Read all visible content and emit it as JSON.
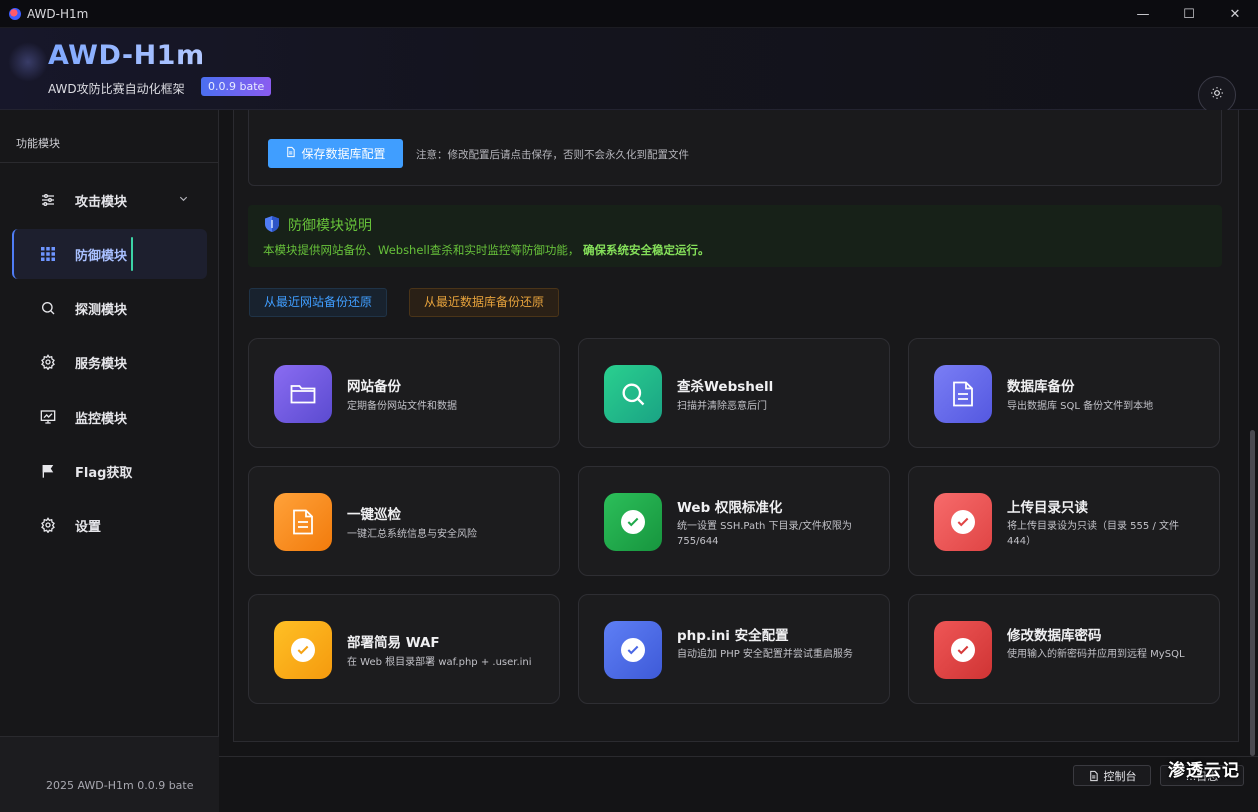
{
  "window": {
    "title": "AWD-H1m",
    "controls": {
      "minimize": "—",
      "maximize": "☐",
      "close": "✕"
    }
  },
  "header": {
    "brand": "AWD-H1m",
    "subtitle": "AWD攻防比赛自动化框架",
    "version": "0.0.9 bate",
    "theme_icon": "sun-icon"
  },
  "sidebar": {
    "section_title": "功能模块",
    "items": [
      {
        "label": "攻击模块",
        "icon": "sliders-icon",
        "has_submenu": true
      },
      {
        "label": "防御模块",
        "icon": "grid-icon",
        "active": true
      },
      {
        "label": "探测模块",
        "icon": "search-icon"
      },
      {
        "label": "服务模块",
        "icon": "gear-icon"
      },
      {
        "label": "监控模块",
        "icon": "monitor-chart-icon"
      },
      {
        "label": "Flag获取",
        "icon": "flag-icon"
      },
      {
        "label": "设置",
        "icon": "gear-icon"
      }
    ],
    "footer": "2025 AWD-H1m 0.0.9 bate"
  },
  "main": {
    "db_config": {
      "save_label": "保存数据库配置",
      "note": "注意：修改配置后请点击保存，否则不会永久化到配置文件"
    },
    "info": {
      "title": "防御模块说明",
      "text": "本模块提供网站备份、Webshell查杀和实时监控等防御功能，",
      "text_bold": "确保系统安全稳定运行。"
    },
    "restore": {
      "web_label": "从最近网站备份还原",
      "db_label": "从最近数据库备份还原"
    },
    "tools": [
      {
        "name": "网站备份",
        "desc": "定期备份网站文件和数据",
        "icon": "folder-icon",
        "color": "#7c5ce0"
      },
      {
        "name": "查杀Webshell",
        "desc": "扫描并清除恶意后门",
        "icon": "search-icon",
        "color": "#22c08a"
      },
      {
        "name": "数据库备份",
        "desc": "导出数据库 SQL 备份文件到本地",
        "icon": "document-icon",
        "color": "#6a6ef0"
      },
      {
        "name": "一键巡检",
        "desc": "一键汇总系统信息与安全风险",
        "icon": "document-icon",
        "color": "#f5901e"
      },
      {
        "name": "Web 权限标准化",
        "desc": "统一设置 SSH.Path 下目录/文件权限为 755/644",
        "icon": "check-circle-icon",
        "color": "#22a84a"
      },
      {
        "name": "上传目录只读",
        "desc": "将上传目录设为只读（目录 555 / 文件 444）",
        "icon": "check-circle-icon",
        "color": "#f05a5a"
      },
      {
        "name": "部署简易 WAF",
        "desc": "在 Web 根目录部署 waf.php + .user.ini",
        "icon": "check-circle-icon",
        "color": "#f7a91a"
      },
      {
        "name": "php.ini 安全配置",
        "desc": "自动追加 PHP 安全配置并尝试重启服务",
        "icon": "check-circle-icon",
        "color": "#4f6ef0"
      },
      {
        "name": "修改数据库密码",
        "desc": "使用输入的新密码并应用到远程 MySQL",
        "icon": "check-circle-icon",
        "color": "#e64a4a"
      }
    ]
  },
  "bottombar": {
    "console_label": "控制台",
    "second_label": "...日志"
  },
  "watermark": "渗透云记"
}
